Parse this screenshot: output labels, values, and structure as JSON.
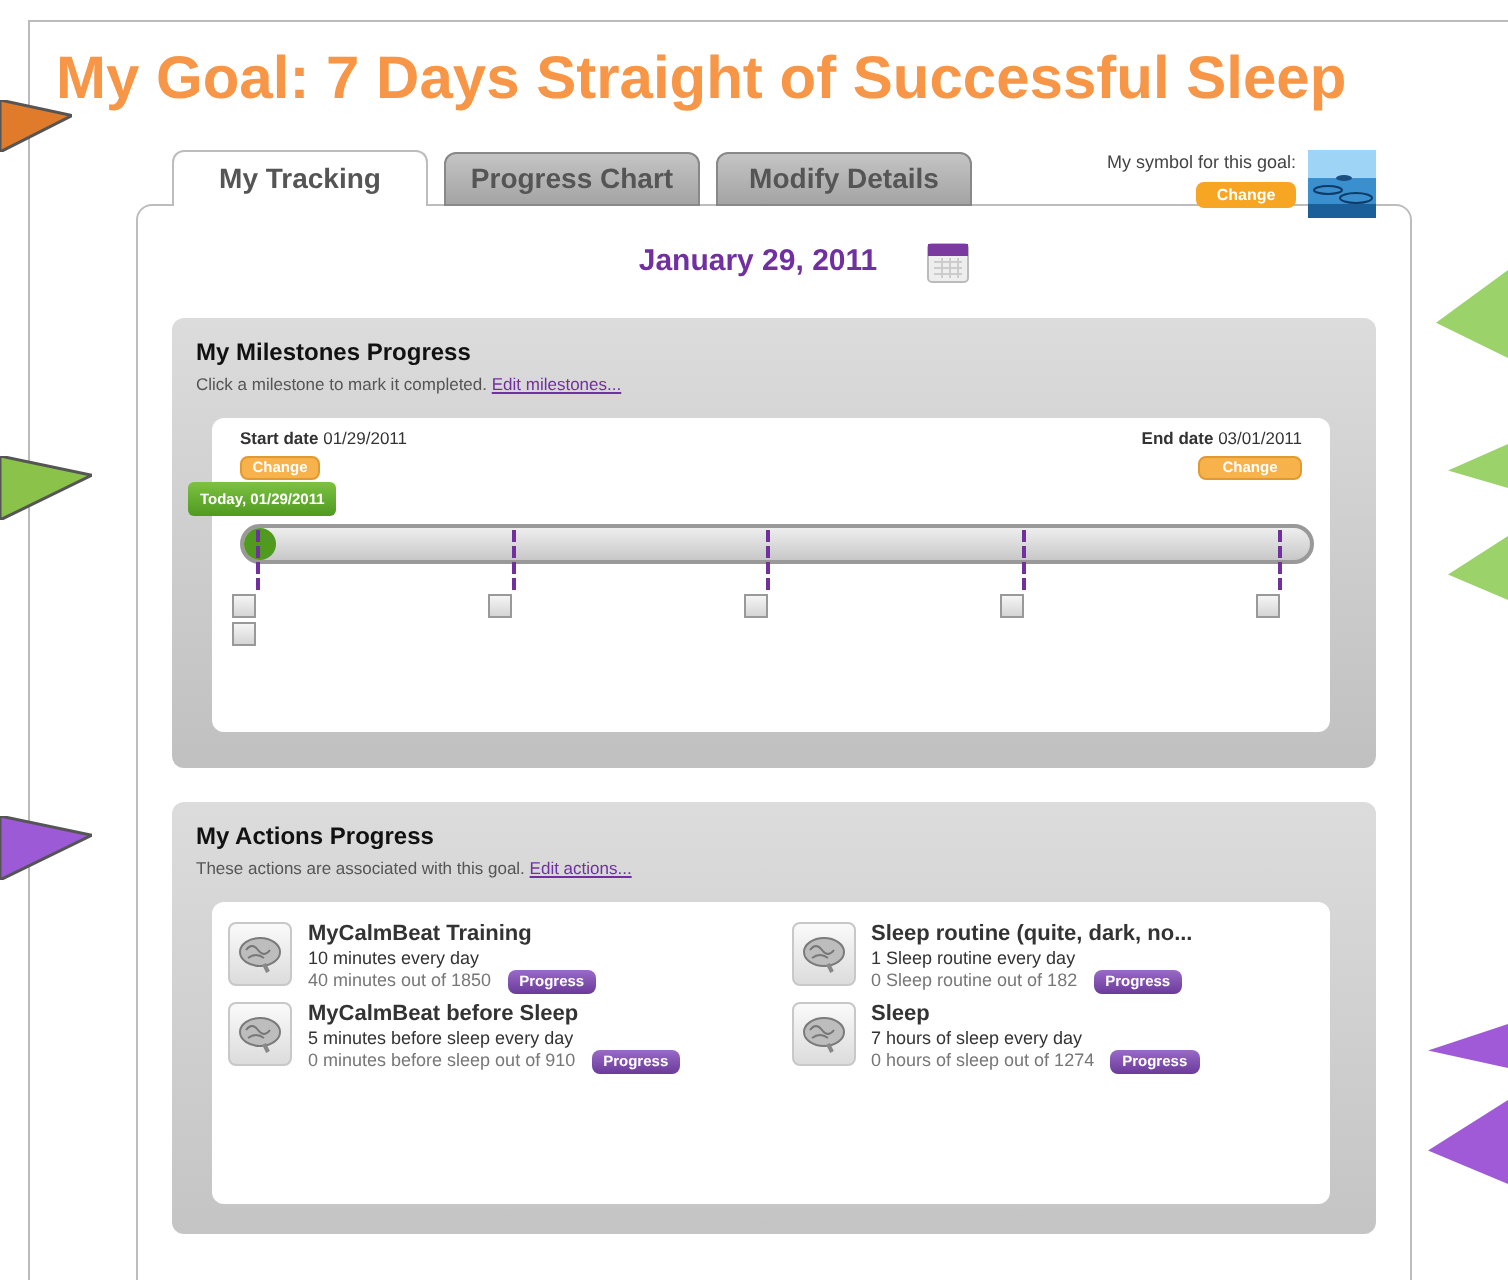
{
  "title": "My Goal: 7 Days Straight of Successful Sleep",
  "tabs": [
    {
      "label": "My Tracking",
      "selected": true
    },
    {
      "label": "Progress Chart",
      "selected": false
    },
    {
      "label": "Modify Details",
      "selected": false
    }
  ],
  "symbol": {
    "label": "My symbol for this goal:",
    "button": "Change"
  },
  "date": "January 29, 2011",
  "milestones": {
    "title": "My Milestones Progress",
    "hint": "Click a milestone to mark it completed.",
    "link": "Edit milestones...",
    "start": {
      "label": "Start date",
      "value": "01/29/2011",
      "button": "Change"
    },
    "end": {
      "label": "End date",
      "value": "03/01/2011",
      "button": "Change"
    },
    "today": {
      "label": "Today,",
      "value": "01/29/2011"
    },
    "level": 0.03,
    "points": [
      {
        "boxes": [
          {
            "checked": false
          },
          {
            "checked": false
          }
        ]
      },
      {
        "boxes": [
          {
            "checked": false
          }
        ]
      },
      {
        "boxes": [
          {
            "checked": false
          }
        ]
      },
      {
        "boxes": [
          {
            "checked": false
          }
        ]
      },
      {
        "boxes": [
          {
            "checked": false
          }
        ]
      }
    ]
  },
  "actions": {
    "title": "My Actions Progress",
    "hint": "These actions are associated with this goal.",
    "link": "Edit actions...",
    "items": [
      {
        "name": "MyCalmBeat Training",
        "target": "10 minutes every day",
        "done": "40 minutes out of 1850",
        "button": "Progress"
      },
      {
        "name": "Sleep routine (quite, dark, no...",
        "target": "1 Sleep routine every day",
        "done": "0 Sleep routine out of 182",
        "button": "Progress"
      },
      {
        "name": "MyCalmBeat before Sleep",
        "target": "5 minutes before sleep every day",
        "done": "0 minutes before sleep out of 910",
        "button": "Progress"
      },
      {
        "name": "Sleep",
        "target": "7 hours of sleep every day",
        "done": "0 hours of sleep out of 1274",
        "button": "Progress"
      }
    ]
  }
}
